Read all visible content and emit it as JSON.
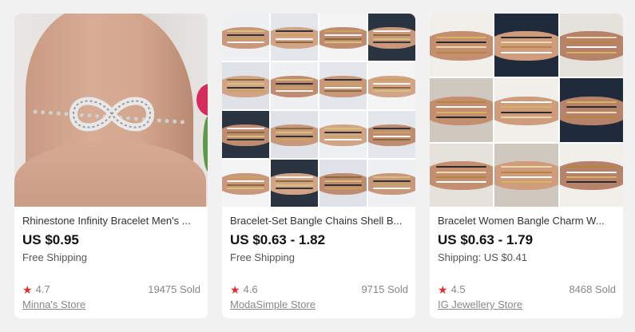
{
  "products": [
    {
      "title": "Rhinestone Infinity Bracelet Men's ...",
      "price": "US $0.95",
      "shipping": "Free Shipping",
      "rating": "4.7",
      "sold": "19475 Sold",
      "store": "Minna's Store"
    },
    {
      "title": "Bracelet-Set Bangle Chains Shell B...",
      "price": "US $0.63 - 1.82",
      "shipping": "Free Shipping",
      "rating": "4.6",
      "sold": "9715 Sold",
      "store": "ModaSimple Store"
    },
    {
      "title": "Bracelet Women Bangle Charm W...",
      "price": "US $0.63 - 1.79",
      "shipping": "Shipping: US $0.41",
      "rating": "4.5",
      "sold": "8468 Sold",
      "store": "IG Jewellery Store"
    }
  ],
  "icons": {
    "rating": "star-icon"
  },
  "colors": {
    "star": "#e02e2e",
    "price": "#111111",
    "background": "#f1f1f1"
  }
}
